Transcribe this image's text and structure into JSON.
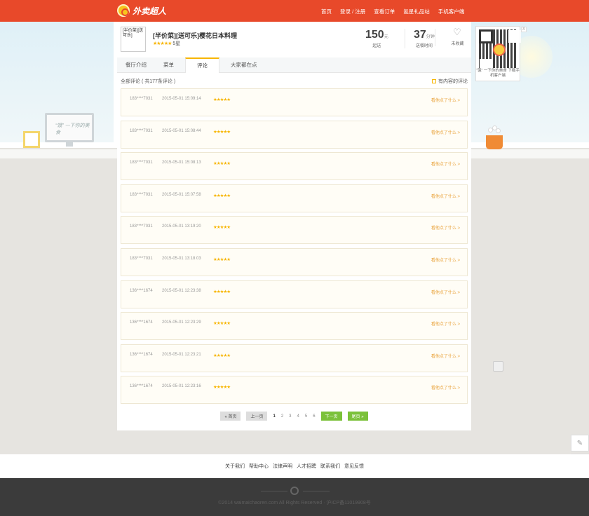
{
  "header": {
    "logo_text": "外卖超人",
    "nav": [
      "首页",
      "登录 / 注册",
      "查看订单",
      "氪星礼品站",
      "手机客户端"
    ]
  },
  "scene": {
    "monitor_text": "“饿” 一下你的美食"
  },
  "restaurant": {
    "logo_text": "[半价菜][送可乐]",
    "name": "[半价菜][送可乐]樱花日本料理",
    "rating_stars": "★★★★★",
    "rating_text": "5星",
    "min_order": "150",
    "min_order_unit": "元",
    "min_order_label": "起送",
    "delivery_time": "37",
    "delivery_time_unit": "分钟",
    "delivery_time_label": "送餐时间",
    "favorite_label": "未收藏"
  },
  "tabs": [
    "餐厅介绍",
    "菜单",
    "评论",
    "大家都在点"
  ],
  "active_tab": 2,
  "reviews_header": {
    "title": "全部评论 ( 共177条评论 )",
    "filter_label": "有内容的评论"
  },
  "reviews": [
    {
      "user": "183****7031",
      "time": "2015-05-01 15:09:14",
      "stars": "★★★★★",
      "more": "看他点了什么 >"
    },
    {
      "user": "183****7031",
      "time": "2015-05-01 15:08:44",
      "stars": "★★★★★",
      "more": "看他点了什么 >"
    },
    {
      "user": "183****7031",
      "time": "2015-05-01 15:08:13",
      "stars": "★★★★★",
      "more": "看他点了什么 >"
    },
    {
      "user": "183****7031",
      "time": "2015-05-01 15:07:58",
      "stars": "★★★★★",
      "more": "看他点了什么 >"
    },
    {
      "user": "183****7031",
      "time": "2015-05-01 13:19:20",
      "stars": "★★★★★",
      "more": "看他点了什么 >"
    },
    {
      "user": "183****7031",
      "time": "2015-05-01 13:18:03",
      "stars": "★★★★★",
      "more": "看他点了什么 >"
    },
    {
      "user": "136****1674",
      "time": "2015-05-01 12:23:38",
      "stars": "★★★★★",
      "more": "看他点了什么 >"
    },
    {
      "user": "136****1674",
      "time": "2015-05-01 12:23:29",
      "stars": "★★★★★",
      "more": "看他点了什么 >"
    },
    {
      "user": "136****1674",
      "time": "2015-05-01 12:23:21",
      "stars": "★★★★★",
      "more": "看他点了什么 >"
    },
    {
      "user": "136****1674",
      "time": "2015-05-01 12:23:16",
      "stars": "★★★★★",
      "more": "看他点了什么 >"
    }
  ],
  "pager": {
    "first": "« 首页",
    "prev": "上一页",
    "pages": [
      "1",
      "2",
      "3",
      "4",
      "5",
      "6"
    ],
    "current": "1",
    "next": "下一页",
    "last": "尾页 »"
  },
  "qr": {
    "caption": "“饿” 一下你的美食 下载手机客户端",
    "close": "X"
  },
  "footer": {
    "links": [
      "关于我们",
      "帮助中心",
      "法律声明",
      "人才招聘",
      "联系我们",
      "意见反馈"
    ],
    "copyright": "©2014 waimaichaoren.com All Rights Reserved · 沪ICP备11019908号"
  },
  "colors": {
    "brand": "#e8492a",
    "star": "#f7b500",
    "pager_green": "#7bc13a"
  }
}
